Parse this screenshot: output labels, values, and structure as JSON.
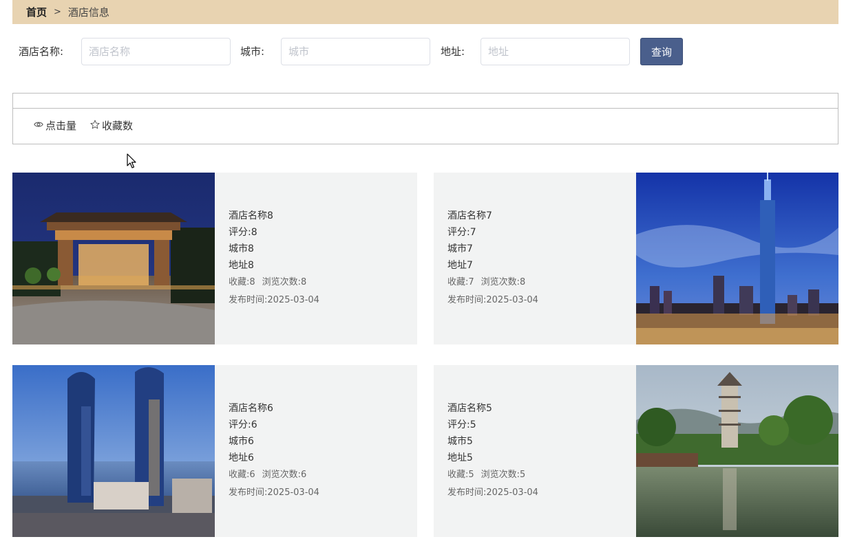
{
  "breadcrumb": {
    "home": "首页",
    "separator": ">",
    "current": "酒店信息"
  },
  "search": {
    "name_label": "酒店名称:",
    "name_placeholder": "酒店名称",
    "city_label": "城市:",
    "city_placeholder": "城市",
    "address_label": "地址:",
    "address_placeholder": "地址",
    "button_label": "查询"
  },
  "sort": {
    "clicks_label": "点击量",
    "favorites_label": "收藏数"
  },
  "colors": {
    "breadcrumb_bg": "#e8d3b1",
    "button_bg": "#4a5f8c",
    "card_bg": "#f2f3f3"
  },
  "cards": [
    {
      "name": "酒店名称8",
      "rating": "评分:8",
      "city": "城市8",
      "address": "地址8",
      "favorites": "收藏:8",
      "views": "浏览次数:8",
      "published": "发布时间:2025-03-04"
    },
    {
      "name": "酒店名称7",
      "rating": "评分:7",
      "city": "城市7",
      "address": "地址7",
      "favorites": "收藏:7",
      "views": "浏览次数:8",
      "published": "发布时间:2025-03-04"
    },
    {
      "name": "酒店名称6",
      "rating": "评分:6",
      "city": "城市6",
      "address": "地址6",
      "favorites": "收藏:6",
      "views": "浏览次数:6",
      "published": "发布时间:2025-03-04"
    },
    {
      "name": "酒店名称5",
      "rating": "评分:5",
      "city": "城市5",
      "address": "地址5",
      "favorites": "收藏:5",
      "views": "浏览次数:5",
      "published": "发布时间:2025-03-04"
    }
  ]
}
